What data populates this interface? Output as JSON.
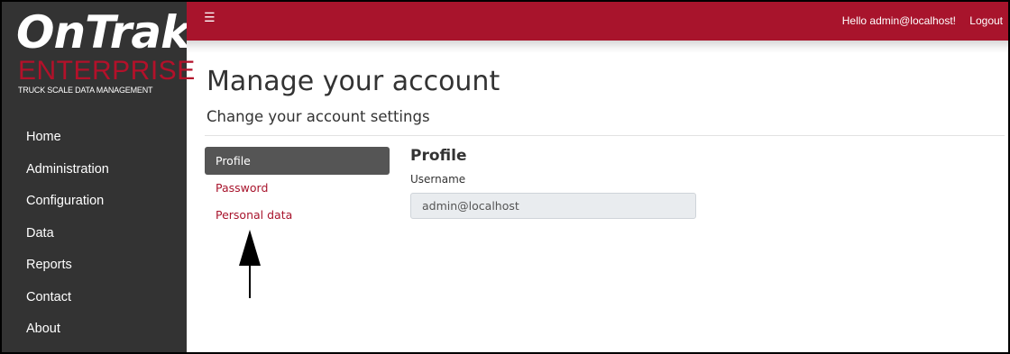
{
  "logo": {
    "brand": "OnTrak",
    "trademark": "™",
    "product": "ENTERPRISE",
    "tagline": "TRUCK SCALE DATA MANAGEMENT"
  },
  "sidebar": {
    "items": [
      {
        "label": "Home"
      },
      {
        "label": "Administration"
      },
      {
        "label": "Configuration"
      },
      {
        "label": "Data"
      },
      {
        "label": "Reports"
      },
      {
        "label": "Contact"
      },
      {
        "label": "About"
      }
    ]
  },
  "topbar": {
    "menu_icon": "hamburger-menu-icon",
    "greeting": "Hello admin@localhost!",
    "logout": "Logout",
    "color": "#a8142c"
  },
  "page": {
    "title": "Manage your account",
    "subtitle": "Change your account settings"
  },
  "account_nav": {
    "items": [
      {
        "label": "Profile",
        "active": true
      },
      {
        "label": "Password",
        "active": false
      },
      {
        "label": "Personal data",
        "active": false
      }
    ]
  },
  "profile": {
    "heading": "Profile",
    "username_label": "Username",
    "username_value": "admin@localhost"
  },
  "colors": {
    "accent": "#a8142c",
    "sidebar": "#333333",
    "active_tab": "#555555"
  }
}
